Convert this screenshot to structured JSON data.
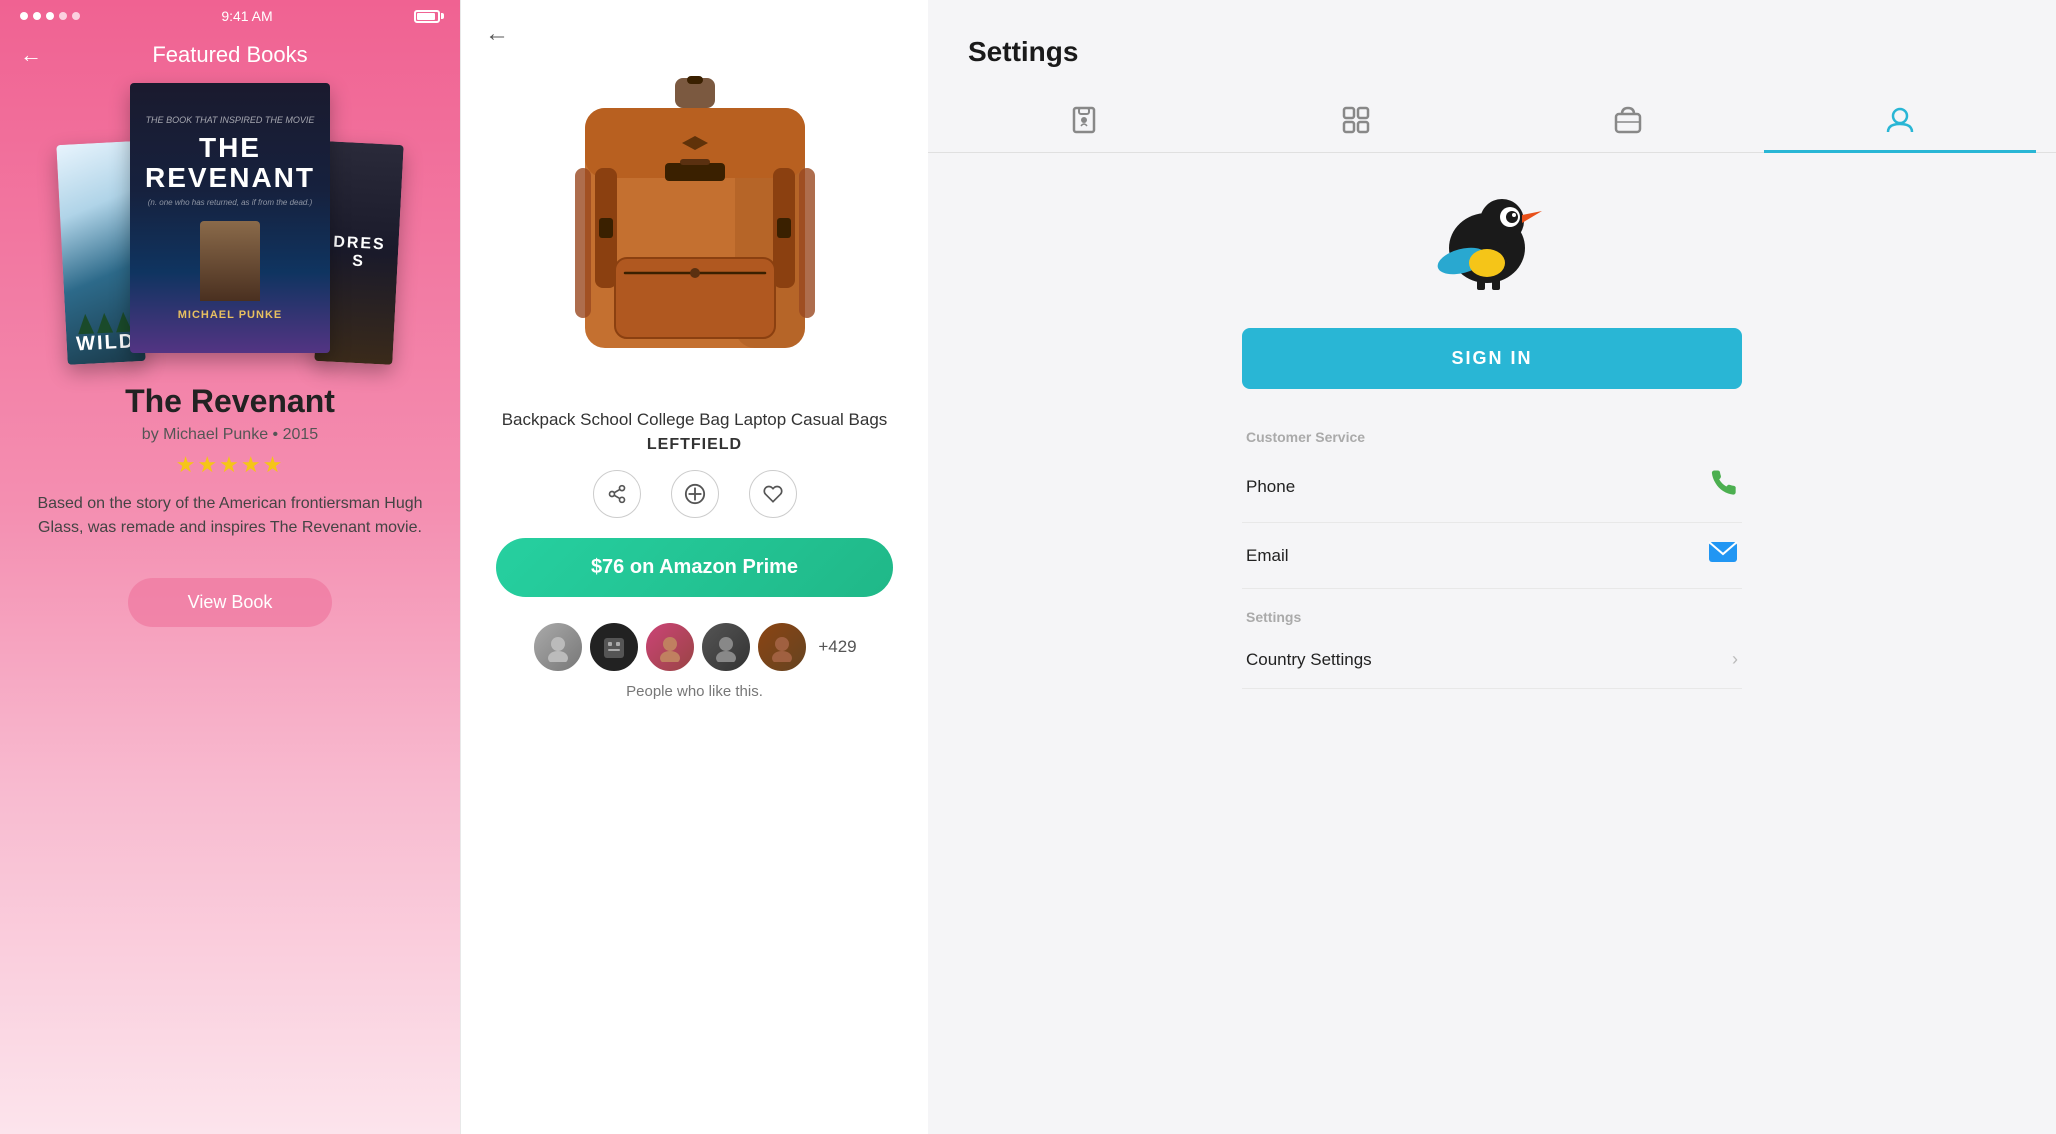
{
  "panel_books": {
    "status_bar": {
      "time": "9:41 AM"
    },
    "header": {
      "back_label": "←",
      "title": "Featured Books"
    },
    "books": [
      {
        "id": "wild",
        "title": "WILD",
        "position": "left"
      },
      {
        "id": "revenant",
        "title": "THE REVENANT",
        "position": "center",
        "tagline": "THE BOOK THAT INSPIRED THE MOVIE",
        "subtitle": "(n. one who has returned, as if from the dead.)",
        "author": "MICHAEL PUNKE"
      },
      {
        "id": "dress",
        "title": "DRES",
        "position": "right"
      }
    ],
    "featured": {
      "title": "The Revenant",
      "author": "by Michael Punke",
      "year": "2015",
      "stars": "★★★★★",
      "description": "Based on the story of the American frontiersman Hugh Glass, was remade and inspires The Revenant movie.",
      "button_label": "View Book"
    }
  },
  "panel_product": {
    "back_label": "←",
    "product_name": "Backpack School College Bag Laptop Casual Bags",
    "brand": "LEFTFIELD",
    "actions": {
      "share": "share-icon",
      "add": "add-icon",
      "heart": "heart-icon"
    },
    "buy_button": "$76 on Amazon Prime",
    "people_count": "+429",
    "people_label": "People who like this."
  },
  "panel_settings": {
    "title": "Settings",
    "tabs": [
      {
        "id": "store",
        "label": "🅱",
        "icon": "store-icon",
        "active": false
      },
      {
        "id": "grid",
        "label": "⊞",
        "icon": "grid-icon",
        "active": false
      },
      {
        "id": "bag",
        "label": "🧳",
        "icon": "bag-icon",
        "active": false
      },
      {
        "id": "profile",
        "label": "👤",
        "icon": "profile-icon",
        "active": true
      }
    ],
    "sign_in_label": "SIGN IN",
    "customer_service": {
      "section_label": "Customer Service",
      "items": [
        {
          "id": "phone",
          "label": "Phone",
          "icon": "phone-icon"
        },
        {
          "id": "email",
          "label": "Email",
          "icon": "email-icon"
        }
      ]
    },
    "settings_section": {
      "section_label": "Settings",
      "items": [
        {
          "id": "country",
          "label": "Country Settings",
          "icon": "chevron-icon"
        }
      ]
    }
  }
}
